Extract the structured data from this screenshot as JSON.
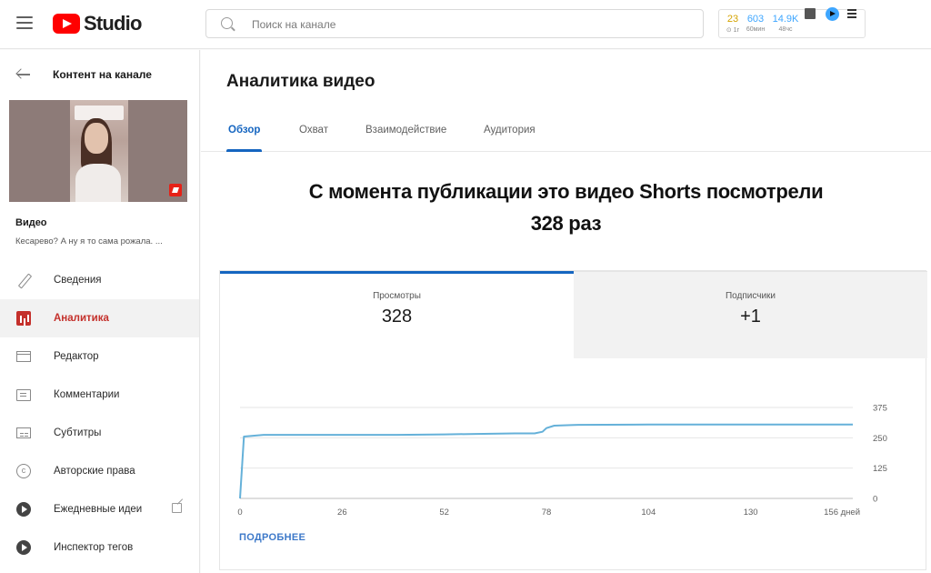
{
  "app": {
    "logo_text": "Studio",
    "brand_color": "#ff0000"
  },
  "search": {
    "placeholder": "Поиск на канале"
  },
  "header_stats": [
    {
      "value": "23",
      "label": "⊙ 1г",
      "color": "#e8b400"
    },
    {
      "value": "603",
      "label": "60мин",
      "color": "#3ea6ff"
    },
    {
      "value": "14.9K",
      "label": "48чс",
      "color": "#3ea6ff"
    }
  ],
  "sidebar": {
    "back_label": "Контент на канале",
    "video_label": "Видео",
    "video_desc": "Кесарево? А ну я то сама рожала. ...",
    "items": [
      {
        "label": "Сведения",
        "icon": "pencil-icon",
        "active": false
      },
      {
        "label": "Аналитика",
        "icon": "analytics-icon",
        "active": true
      },
      {
        "label": "Редактор",
        "icon": "editor-icon",
        "active": false
      },
      {
        "label": "Комментарии",
        "icon": "comments-icon",
        "active": false
      },
      {
        "label": "Субтитры",
        "icon": "subtitles-icon",
        "active": false
      },
      {
        "label": "Авторские права",
        "icon": "copyright-icon",
        "active": false
      },
      {
        "label": "Ежедневные идеи",
        "icon": "daily-ideas-icon",
        "active": false
      },
      {
        "label": "Инспектор тегов",
        "icon": "tag-inspector-icon",
        "active": false
      }
    ]
  },
  "main": {
    "title": "Аналитика видео",
    "tabs": [
      "Обзор",
      "Охват",
      "Взаимодействие",
      "Аудитория"
    ],
    "headline_line1": "С момента публикации это видео Shorts посмотрели",
    "headline_line2": "328 раз",
    "metrics": [
      {
        "label": "Просмотры",
        "value": "328"
      },
      {
        "label": "Подписчики",
        "value": "+1"
      }
    ],
    "more_link": "ПОДРОБНЕЕ"
  },
  "chart_data": {
    "type": "line",
    "x_ticks": [
      "0",
      "26",
      "52",
      "78",
      "104",
      "130",
      "156 дней"
    ],
    "y_ticks": [
      "0",
      "125",
      "250",
      "375"
    ],
    "ylim": [
      0,
      375
    ],
    "xlim": [
      0,
      156
    ],
    "line_color": "#65b1d9",
    "x": [
      0,
      1,
      3,
      6,
      20,
      40,
      52,
      60,
      70,
      75,
      77,
      78,
      80,
      85,
      100,
      104,
      120,
      156
    ],
    "y": [
      0,
      255,
      258,
      262,
      262,
      262,
      264,
      266,
      268,
      268,
      275,
      290,
      300,
      303,
      304,
      305,
      305,
      305
    ]
  }
}
